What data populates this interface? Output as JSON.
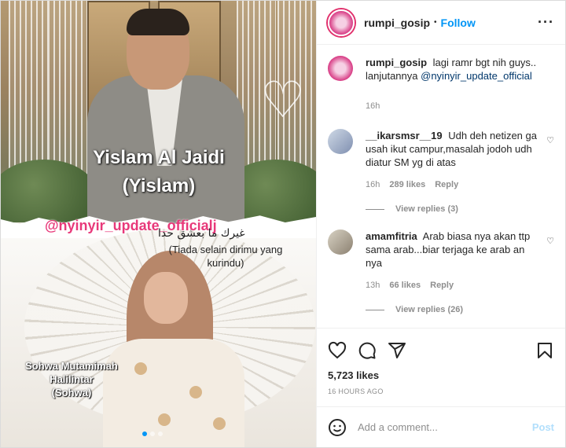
{
  "media": {
    "name_top_line1": "Yislam Al Jaidi",
    "name_top_line2": "(Yislam)",
    "watermark_handle": "@nyinyir_update_officialj",
    "arabic_text": "غيرك ما بعشق حدا",
    "translation": "(Tiada selain dirimu yang kurindu)",
    "name_bottom_line1": "Sohwa Mutamimah",
    "name_bottom_line2": "Halilintar",
    "name_bottom_line3": "(Sohwa)"
  },
  "header": {
    "username": "rumpi_gosip",
    "separator": "•",
    "follow_label": "Follow",
    "more_label": "···"
  },
  "caption": {
    "username": "rumpi_gosip",
    "text": "lagi ramr bgt nih guys.. lanjutannya ",
    "mention": "@nyinyir_update_official",
    "time": "16h"
  },
  "comments": [
    {
      "username": "__ikarsmsr__19",
      "text": "Udh deh netizen ga usah ikut campur,masalah jodoh udh diatur SM yg di atas",
      "time": "16h",
      "likes": "289 likes",
      "reply_label": "Reply",
      "view_replies": "View replies (3)"
    },
    {
      "username": "amamfitria",
      "text": "Arab biasa nya akan ttp sama arab...biar terjaga ke arab an nya",
      "time": "13h",
      "likes": "66 likes",
      "reply_label": "Reply",
      "view_replies": "View replies (26)"
    }
  ],
  "actions": {
    "like_icon": "heart-icon",
    "comment_icon": "comment-icon",
    "share_icon": "share-icon",
    "save_icon": "bookmark-icon",
    "likes": "5,723 likes",
    "timestamp": "16 HOURS AGO"
  },
  "add_comment": {
    "emoji_icon": "emoji-icon",
    "placeholder": "Add a comment...",
    "post_label": "Post"
  },
  "colors": {
    "accent": "#0095f6",
    "watermark": "#e8397a",
    "post_disabled": "#b2dffc"
  }
}
